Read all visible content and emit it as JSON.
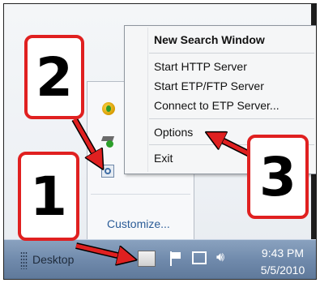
{
  "menu": {
    "items": [
      {
        "label": "New Search Window"
      },
      {
        "label": "Start HTTP Server"
      },
      {
        "label": "Start ETP/FTP Server"
      },
      {
        "label": "Connect to ETP Server..."
      },
      {
        "label": "Options"
      },
      {
        "label": "Exit"
      }
    ]
  },
  "flyout": {
    "customize_label": "Customize..."
  },
  "taskbar": {
    "desktop_label": "Desktop",
    "time": "9:43 PM",
    "date": "5/5/2010"
  },
  "callouts": {
    "one": "1",
    "two": "2",
    "three": "3"
  },
  "colors": {
    "callout_border": "#e02020",
    "arrow": "#e02020",
    "taskbar": "#6f89ab"
  },
  "icons": [
    "flag-icon",
    "network-icon",
    "volume-icon",
    "grip-icon"
  ]
}
